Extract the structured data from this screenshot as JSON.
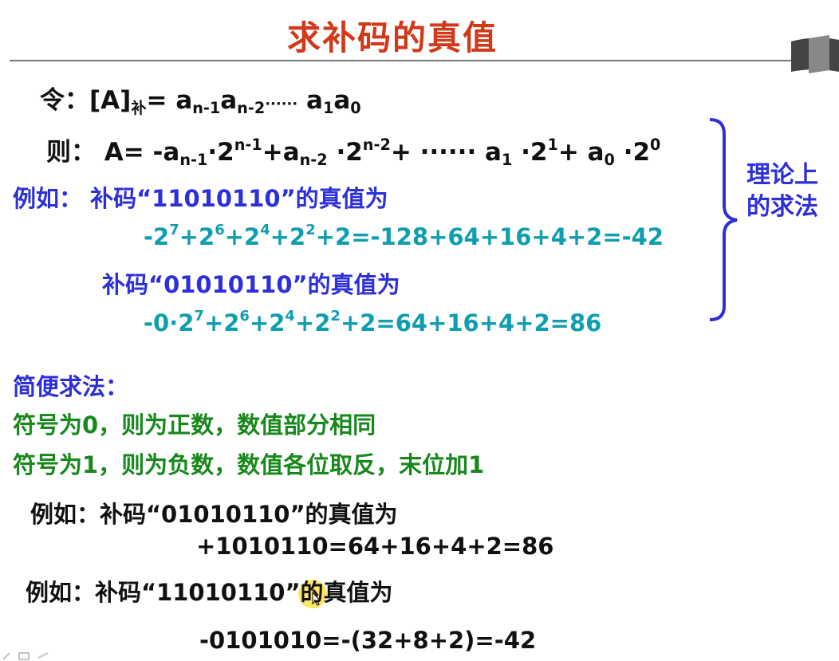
{
  "title": "求补码的真值",
  "def_line": {
    "label": "令：[A]",
    "sub_label": "补",
    "eq": "= a",
    "t1_sub": "n-1",
    "t2": "a",
    "t2_sub": "n-2",
    "dots": "······",
    "t3": " a",
    "t3_sub": "1",
    "t4": "a",
    "t4_sub": "0"
  },
  "then_line": {
    "label": "则：  A= -a",
    "s1": "n-1",
    "p1": "·2",
    "e1": "n-1",
    "plus1": "+a",
    "s2": "n-2",
    "p2": " ·2",
    "e2": "n-2",
    "plus2": "+  ······  a",
    "s3": "1",
    "p3": " ·2",
    "e3": "1",
    "plus3": "+ a",
    "s4": "0",
    "p4": " ·2",
    "e4": "0"
  },
  "example1": {
    "label": "例如：  补码",
    "code": "“11010110”",
    "suffix": "的真值为"
  },
  "calc1": {
    "a": "-2",
    "ae": "7",
    "b": "+2",
    "be": "6",
    "c": "+2",
    "ce": "4",
    "d": "+2",
    "de": "2",
    "rest": "+2=-128+64+16+4+2=-42"
  },
  "example2": {
    "label": "补码",
    "code": "“01010110”",
    "suffix": "的真值为"
  },
  "calc2": {
    "a": "-0·2",
    "ae": "7",
    "b": "+2",
    "be": "6",
    "c": "+2",
    "ce": "4",
    "d": "+2",
    "de": "2",
    "rest": "+2=64+16+4+2=86"
  },
  "brace_label": "理论上的求法",
  "simple": {
    "heading": "简便求法：",
    "rule0": "符号为0，则为正数，数值部分相同",
    "rule1": "符号为1，则为负数，数值各位取反，末位加1"
  },
  "example3": {
    "line": "例如：补码“01010110”的真值为",
    "result": "+1010110=64+16+4+2=86"
  },
  "example4": {
    "line": "例如：补码“11010110”的真值为",
    "result": "-0101010=-(32+8+2)=-42"
  },
  "colors": {
    "title": "#d0391a",
    "blue": "#2d2fd8",
    "teal": "#0f9db0",
    "green": "#17881c",
    "text": "#111111"
  }
}
